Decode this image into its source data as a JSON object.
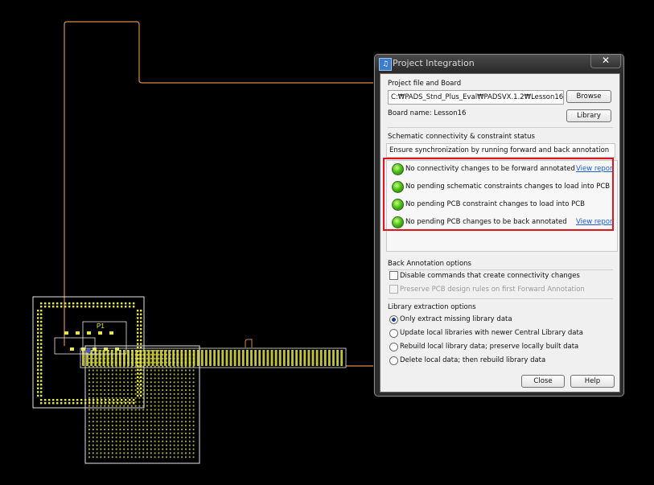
{
  "window": {
    "title": "Project Integration",
    "close_glyph": "✕",
    "app_icon": "project-integration-icon"
  },
  "project": {
    "section_label": "Project file and Board",
    "file_path": "C:₩PADS_Stnd_Plus_Eval₩PADSVX.1.2₩Lesson16₩Les",
    "browse_label": "Browse",
    "board_name": "Board name: Lesson16",
    "library_label": "Library"
  },
  "status": {
    "section_label": "Schematic connectivity & constraint status",
    "sync_message": "Ensure synchronization by running forward and back annotation",
    "items": [
      {
        "text": "No connectivity changes to be forward annotated",
        "link": "View repor"
      },
      {
        "text": "No pending schematic constraints changes to load into PCB",
        "link": ""
      },
      {
        "text": "No pending PCB constraint changes to load into PCB",
        "link": ""
      },
      {
        "text": "No pending PCB changes to be back annotated",
        "link": "View repor"
      }
    ]
  },
  "back_annotation": {
    "section_label": "Back Annotation options",
    "opt1": "Disable commands that create connectivity changes",
    "opt2": "Preserve PCB design rules on first Forward Annotation"
  },
  "library_extraction": {
    "section_label": "Library extraction options",
    "options": [
      "Only extract missing library data",
      "Update local libraries with newer Central Library data",
      "Rebuild local library data; preserve locally built data",
      "Delete local data; then rebuild library data"
    ],
    "selected_index": 0
  },
  "footer": {
    "close_label": "Close",
    "help_label": "Help"
  },
  "pcb": {
    "label": "P1"
  },
  "colors": {
    "trace_orange": "#d88a4a",
    "outline_white": "#e6e6e6",
    "copper_yellow": "#e6e645",
    "highlight_red": "#e0151b"
  }
}
